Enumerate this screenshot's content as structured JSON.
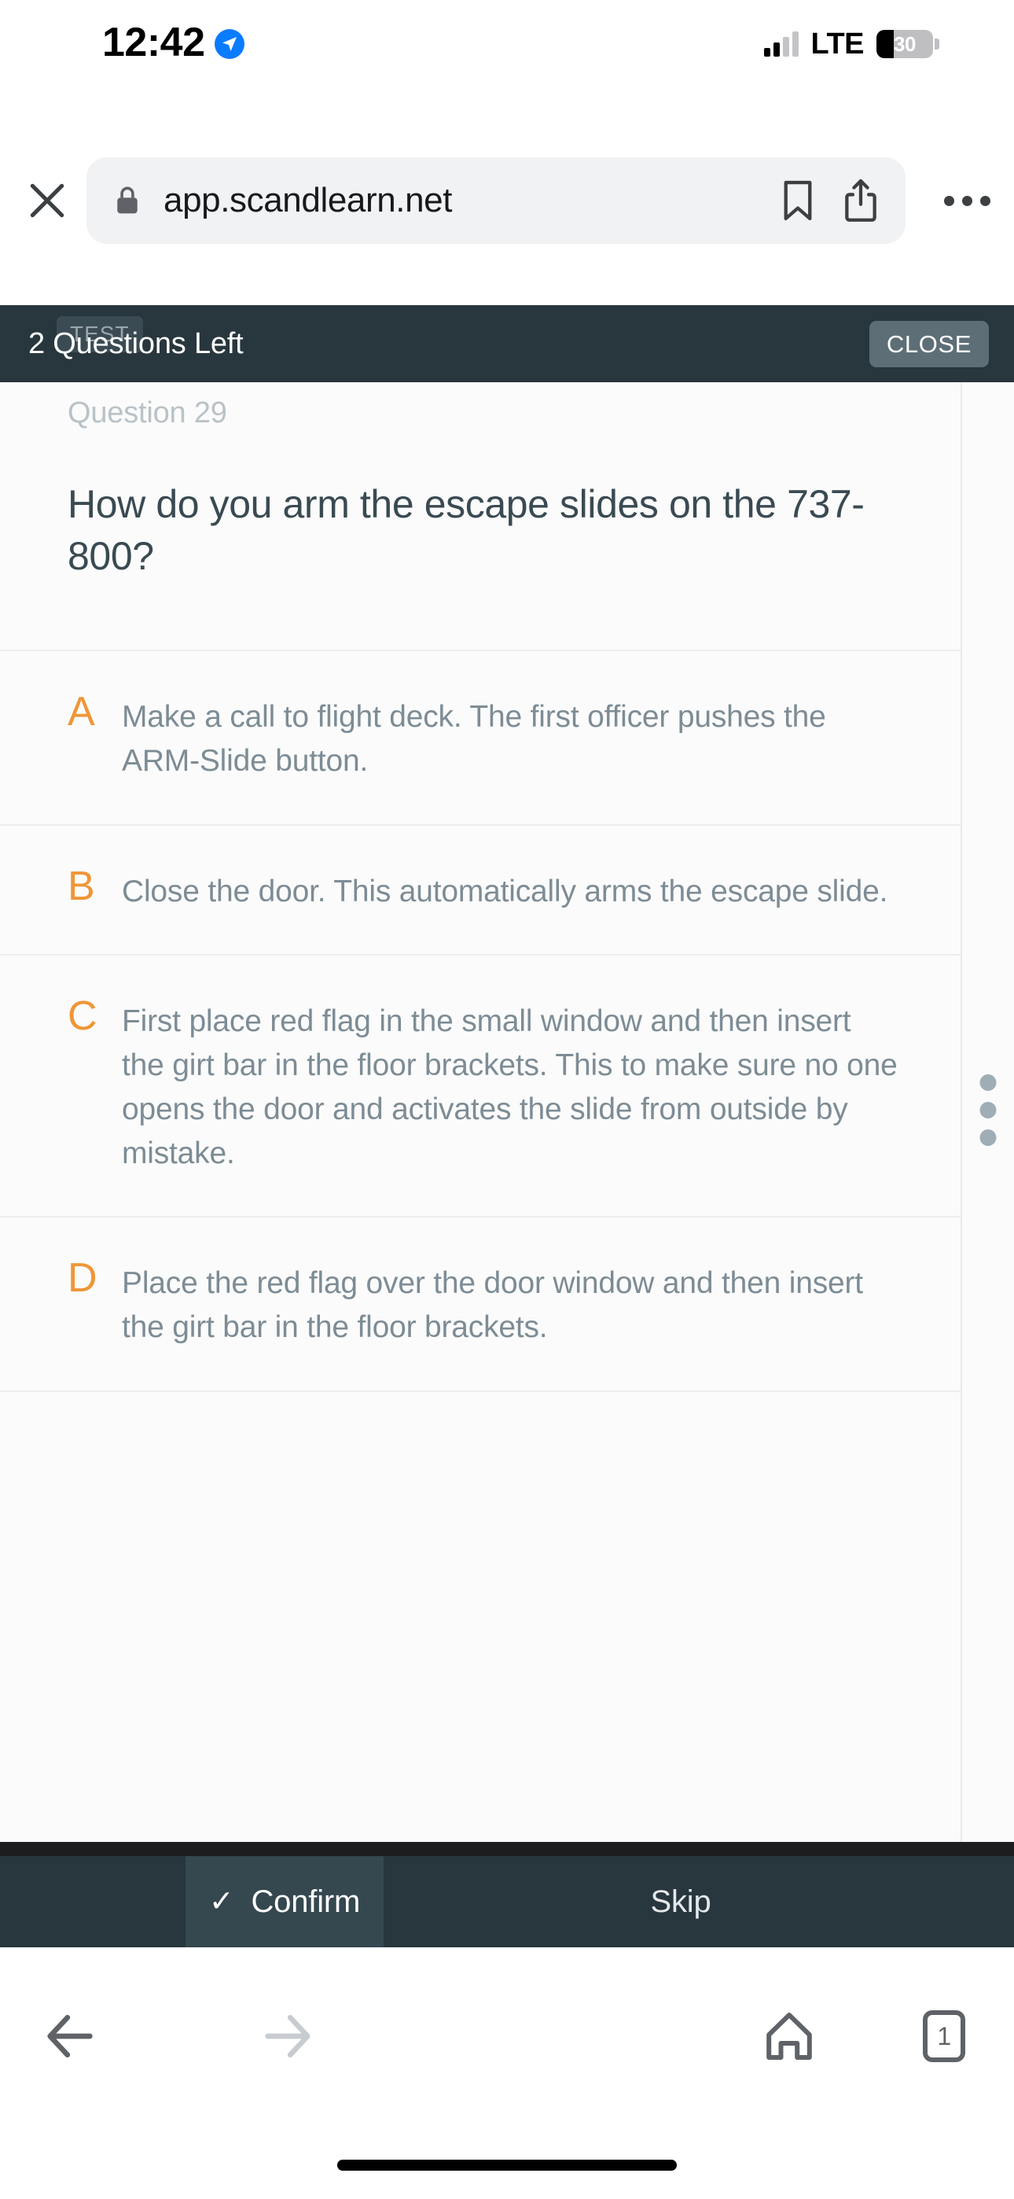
{
  "status_bar": {
    "time": "12:42",
    "location_icon": "location-arrow-icon",
    "network_label": "LTE",
    "battery_percent": "30",
    "battery_level": 30
  },
  "browser": {
    "close_label": "close-icon",
    "security_icon": "lock-icon",
    "url": "app.scandlearn.net",
    "bookmark_icon": "bookmark-icon",
    "share_icon": "share-icon",
    "more_icon": "more-horizontal-icon",
    "nav": {
      "back_icon": "arrow-left-icon",
      "forward_icon": "arrow-right-icon",
      "home_icon": "home-icon",
      "tab_count": "1"
    }
  },
  "app_header": {
    "test_badge": "TEST",
    "questions_left": "2 Questions Left",
    "close_button": "CLOSE"
  },
  "quiz": {
    "question_number": "Question 29",
    "question_text": "How do you arm the escape slides on the 737-800?",
    "options": [
      {
        "letter": "A",
        "text": "Make a call to flight deck. The first officer pushes the ARM-Slide button."
      },
      {
        "letter": "B",
        "text": "Close the door. This automatically arms the escape slide."
      },
      {
        "letter": "C",
        "text": "First place red flag in the small window and then insert the girt bar in the floor brackets. This to make sure no one opens the door and activates the slide from outside by mistake."
      },
      {
        "letter": "D",
        "text": "Place the red flag over the door window and then insert the girt bar in the floor brackets."
      }
    ]
  },
  "action_bar": {
    "confirm_label": "Confirm",
    "confirm_check": "✓",
    "skip_label": "Skip"
  },
  "colors": {
    "header_dark": "#28363d",
    "option_letter_orange": "#ef9636",
    "body_text_gray": "#7d8c95",
    "question_text": "#3a4a52",
    "accent_blue": "#0a7cff"
  }
}
